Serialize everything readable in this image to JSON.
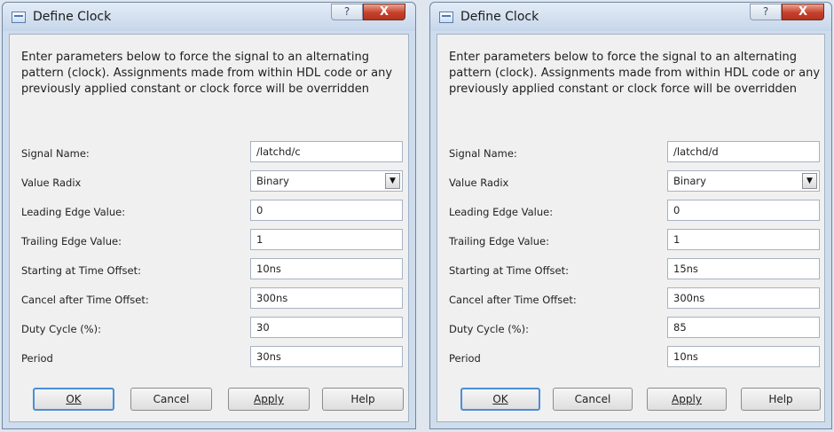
{
  "dialogs": [
    {
      "title": "Define Clock",
      "help_glyph": "?",
      "close_glyph": "X",
      "description": "Enter parameters below to force the signal to an alternating pattern (clock). Assignments made from within HDL code or any previously applied constant or clock force will be overridden",
      "fields": {
        "signal_name": {
          "label": "Signal Name:",
          "value": "/latchd/c"
        },
        "value_radix": {
          "label": "Value Radix",
          "value": "Binary"
        },
        "leading_edge": {
          "label": "Leading Edge Value:",
          "value": "0"
        },
        "trailing_edge": {
          "label": "Trailing Edge Value:",
          "value": "1"
        },
        "start_offset": {
          "label": "Starting at Time Offset:",
          "value": "10ns"
        },
        "cancel_offset": {
          "label": "Cancel after Time Offset:",
          "value": "300ns"
        },
        "duty_cycle": {
          "label": "Duty Cycle (%):",
          "value": "30"
        },
        "period": {
          "label": "Period",
          "value": "30ns"
        }
      },
      "buttons": {
        "ok": "OK",
        "cancel": "Cancel",
        "apply": "Apply",
        "help": "Help"
      }
    },
    {
      "title": "Define Clock",
      "help_glyph": "?",
      "close_glyph": "X",
      "description": "Enter parameters below to force the signal to an alternating pattern (clock). Assignments made from within HDL code or any previously applied constant or clock force will be overridden",
      "fields": {
        "signal_name": {
          "label": "Signal Name:",
          "value": "/latchd/d"
        },
        "value_radix": {
          "label": "Value Radix",
          "value": "Binary"
        },
        "leading_edge": {
          "label": "Leading Edge Value:",
          "value": "0"
        },
        "trailing_edge": {
          "label": "Trailing Edge Value:",
          "value": "1"
        },
        "start_offset": {
          "label": "Starting at Time Offset:",
          "value": "15ns"
        },
        "cancel_offset": {
          "label": "Cancel after Time Offset:",
          "value": "300ns"
        },
        "duty_cycle": {
          "label": "Duty Cycle (%):",
          "value": "85"
        },
        "period": {
          "label": "Period",
          "value": "10ns"
        }
      },
      "buttons": {
        "ok": "OK",
        "cancel": "Cancel",
        "apply": "Apply",
        "help": "Help"
      }
    }
  ]
}
